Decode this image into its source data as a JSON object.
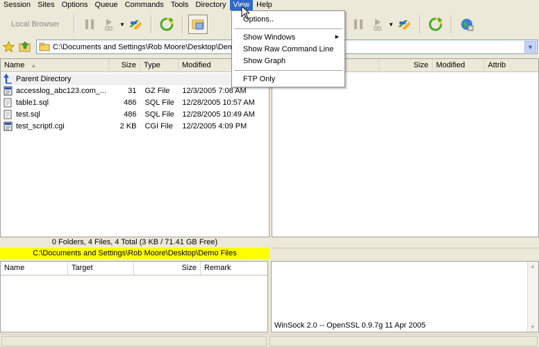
{
  "menubar": {
    "items": [
      "Session",
      "Sites",
      "Options",
      "Queue",
      "Commands",
      "Tools",
      "Directory",
      "View",
      "Help"
    ],
    "active_index": 7
  },
  "toolbar": {
    "local_label": "Local Browser"
  },
  "address_bar": {
    "path": "C:\\Documents and Settings\\Rob Moore\\Desktop\\Demo Files"
  },
  "local_pane": {
    "columns": [
      "Name",
      "Size",
      "Type",
      "Modified"
    ],
    "sort_indicator": "▲",
    "parent_label": "Parent Directory",
    "files": [
      {
        "name": "accesslog_abc123.com_...",
        "size": "31",
        "type": "GZ File",
        "modified": "12/3/2005 7:08 AM"
      },
      {
        "name": "table1.sql",
        "size": "486",
        "type": "SQL File",
        "modified": "12/28/2005 10:57 AM"
      },
      {
        "name": "test.sql",
        "size": "486",
        "type": "SQL File",
        "modified": "12/28/2005 10:49 AM"
      },
      {
        "name": "test_scriptl.cgi",
        "size": "2 KB",
        "type": "CGI File",
        "modified": "12/2/2005 4:09 PM"
      }
    ],
    "summary": "0 Folders, 4 Files, 4 Total (3 KB / 71.41 GB Free)",
    "current_path": "C:\\Documents and Settings\\Rob Moore\\Desktop\\Demo Files"
  },
  "remote_pane": {
    "columns": [
      "Size",
      "Modified",
      "Attrib"
    ]
  },
  "queue_pane": {
    "columns": [
      "Name",
      "Target",
      "Size",
      "Remark"
    ]
  },
  "log_pane": {
    "line": "WinSock 2.0 -- OpenSSL 0.9.7g 11 Apr 2005"
  },
  "view_menu": {
    "options": "Options..",
    "show_windows": "Show Windows",
    "show_raw": "Show Raw Command Line",
    "show_graph": "Show Graph",
    "ftp_only": "FTP Only",
    "submenu_arrow": "▶"
  },
  "colors": {
    "menu_highlight": "#316ac5",
    "path_highlight": "#ffff00"
  }
}
